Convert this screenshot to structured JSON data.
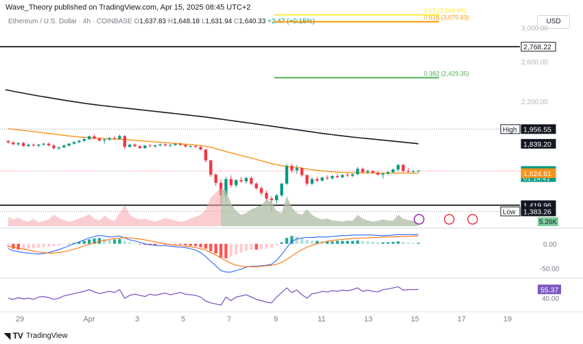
{
  "header": {
    "published": "Wave_Theory published on TradingView.com, Apr 15, 2025 08:45 UTC+2"
  },
  "legend": {
    "symbol": "Ethereum / U.S. Dollar · 4h · COINBASE",
    "o_label": "O",
    "o": "1,637.83",
    "h_label": "H",
    "h": "1,648.18",
    "l_label": "L",
    "l": "1,631.94",
    "c_label": "C",
    "c": "1,640.33",
    "change": "+2.47 (+0.15%)"
  },
  "currency_button": "USD",
  "footer": {
    "brand": "TradingView"
  },
  "colors": {
    "up": "#089981",
    "down": "#f23645",
    "ema": "#f7931a",
    "sma": "#131722",
    "fib382": "#4caf50",
    "fib618": "#ff9800",
    "fibtop": "#ffeb3b",
    "rsi": "#7e57c2",
    "macd": "#2962ff",
    "signal": "#ff6d00"
  },
  "chart_data": {
    "type": "line",
    "title": "Ethereum / U.S. Dollar · 4h · COINBASE",
    "x_ticks": [
      "29",
      "Apr",
      "3",
      "5",
      "7",
      "9",
      "11",
      "13",
      "15",
      "17",
      "19"
    ],
    "y_ticks": [
      "3,000.00",
      "2,600.00",
      "2,200.00",
      "1,956.55",
      "1,839.20",
      "1,640.33",
      "1,624.61",
      "1,419.96",
      "1,383.26"
    ],
    "price_scale": "log",
    "y_range": [
      1300,
      3200
    ],
    "price_axis_labels": [
      {
        "text": "2,768.22",
        "kind": "line"
      },
      {
        "text": "1,956.55",
        "prefix": "High",
        "kind": "dark"
      },
      {
        "text": "1,839.20",
        "kind": "dark"
      },
      {
        "text": "1,640.33",
        "sub": "01:14:41",
        "kind": "last"
      },
      {
        "text": "1,624.61",
        "kind": "ema"
      },
      {
        "text": "1,419.96",
        "kind": "dark"
      },
      {
        "text": "1,383.26",
        "prefix": "Low",
        "kind": "dark"
      }
    ],
    "horizontal_levels": [
      {
        "value": 2768.22,
        "style": "solid"
      },
      {
        "value": 1419.96,
        "style": "solid"
      },
      {
        "value": 1383.26,
        "style": "dotted"
      },
      {
        "value": 1956.55,
        "style": "dotted"
      }
    ],
    "fib_levels": [
      {
        "label": "0.382 (2,429.35)",
        "value": 2429.35
      },
      {
        "label": "0.618 (3,075.63)",
        "value": 3075.63
      },
      {
        "label": "0.65 (3,166.99)",
        "value": 3166.99
      }
    ],
    "candles": [
      [
        1860,
        1870,
        1840,
        1850
      ],
      [
        1850,
        1858,
        1828,
        1835
      ],
      [
        1835,
        1848,
        1825,
        1845
      ],
      [
        1845,
        1855,
        1815,
        1822
      ],
      [
        1822,
        1840,
        1812,
        1832
      ],
      [
        1832,
        1842,
        1818,
        1825
      ],
      [
        1825,
        1838,
        1812,
        1833
      ],
      [
        1833,
        1845,
        1826,
        1840
      ],
      [
        1840,
        1848,
        1820,
        1826
      ],
      [
        1826,
        1835,
        1795,
        1805
      ],
      [
        1805,
        1818,
        1790,
        1812
      ],
      [
        1812,
        1832,
        1805,
        1826
      ],
      [
        1826,
        1845,
        1818,
        1840
      ],
      [
        1840,
        1860,
        1832,
        1852
      ],
      [
        1852,
        1870,
        1845,
        1862
      ],
      [
        1862,
        1885,
        1855,
        1876
      ],
      [
        1876,
        1905,
        1870,
        1898
      ],
      [
        1898,
        1912,
        1872,
        1880
      ],
      [
        1880,
        1890,
        1855,
        1865
      ],
      [
        1865,
        1878,
        1840,
        1872
      ],
      [
        1872,
        1890,
        1862,
        1884
      ],
      [
        1884,
        1900,
        1870,
        1878
      ],
      [
        1878,
        1912,
        1870,
        1900
      ],
      [
        1900,
        1908,
        1800,
        1815
      ],
      [
        1815,
        1840,
        1810,
        1832
      ],
      [
        1832,
        1842,
        1815,
        1820
      ],
      [
        1820,
        1830,
        1800,
        1806
      ],
      [
        1806,
        1830,
        1800,
        1825
      ],
      [
        1825,
        1838,
        1815,
        1820
      ],
      [
        1820,
        1832,
        1806,
        1828
      ],
      [
        1828,
        1840,
        1818,
        1835
      ],
      [
        1835,
        1842,
        1820,
        1826
      ],
      [
        1826,
        1838,
        1815,
        1830
      ],
      [
        1830,
        1845,
        1822,
        1838
      ],
      [
        1838,
        1848,
        1825,
        1830
      ],
      [
        1830,
        1836,
        1812,
        1818
      ],
      [
        1818,
        1826,
        1808,
        1822
      ],
      [
        1822,
        1828,
        1810,
        1815
      ],
      [
        1815,
        1820,
        1790,
        1795
      ],
      [
        1795,
        1800,
        1700,
        1715
      ],
      [
        1715,
        1720,
        1600,
        1615
      ],
      [
        1615,
        1625,
        1540,
        1560
      ],
      [
        1560,
        1585,
        1420,
        1480
      ],
      [
        1480,
        1600,
        1440,
        1585
      ],
      [
        1585,
        1610,
        1530,
        1545
      ],
      [
        1545,
        1585,
        1530,
        1578
      ],
      [
        1578,
        1600,
        1560,
        1570
      ],
      [
        1570,
        1600,
        1555,
        1592
      ],
      [
        1592,
        1605,
        1545,
        1555
      ],
      [
        1555,
        1565,
        1515,
        1525
      ],
      [
        1525,
        1540,
        1480,
        1495
      ],
      [
        1495,
        1510,
        1440,
        1460
      ],
      [
        1460,
        1475,
        1383,
        1450
      ],
      [
        1450,
        1490,
        1430,
        1480
      ],
      [
        1480,
        1560,
        1470,
        1555
      ],
      [
        1555,
        1690,
        1545,
        1675
      ],
      [
        1675,
        1690,
        1630,
        1645
      ],
      [
        1645,
        1680,
        1620,
        1660
      ],
      [
        1660,
        1665,
        1600,
        1612
      ],
      [
        1612,
        1618,
        1540,
        1555
      ],
      [
        1555,
        1595,
        1545,
        1585
      ],
      [
        1585,
        1600,
        1565,
        1575
      ],
      [
        1575,
        1600,
        1568,
        1595
      ],
      [
        1595,
        1610,
        1580,
        1590
      ],
      [
        1590,
        1612,
        1582,
        1605
      ],
      [
        1605,
        1620,
        1592,
        1598
      ],
      [
        1598,
        1618,
        1590,
        1612
      ],
      [
        1612,
        1625,
        1600,
        1608
      ],
      [
        1608,
        1622,
        1598,
        1618
      ],
      [
        1618,
        1668,
        1612,
        1655
      ],
      [
        1655,
        1665,
        1625,
        1632
      ],
      [
        1632,
        1650,
        1620,
        1640
      ],
      [
        1640,
        1648,
        1622,
        1628
      ],
      [
        1628,
        1640,
        1610,
        1615
      ],
      [
        1615,
        1628,
        1590,
        1622
      ],
      [
        1622,
        1640,
        1612,
        1632
      ],
      [
        1632,
        1658,
        1625,
        1650
      ],
      [
        1650,
        1690,
        1640,
        1682
      ],
      [
        1682,
        1692,
        1630,
        1640
      ],
      [
        1640,
        1660,
        1625,
        1635
      ],
      [
        1635,
        1648,
        1630,
        1637
      ],
      [
        1637,
        1648,
        1631,
        1640
      ]
    ],
    "ema": [
      1960,
      1955,
      1950,
      1946,
      1941,
      1936,
      1931,
      1926,
      1921,
      1916,
      1911,
      1906,
      1901,
      1897,
      1893,
      1890,
      1887,
      1885,
      1883,
      1880,
      1878,
      1876,
      1874,
      1872,
      1869,
      1866,
      1863,
      1860,
      1857,
      1854,
      1851,
      1848,
      1845,
      1842,
      1839,
      1836,
      1833,
      1830,
      1826,
      1820,
      1812,
      1802,
      1790,
      1780,
      1770,
      1760,
      1750,
      1741,
      1732,
      1722,
      1712,
      1702,
      1692,
      1684,
      1677,
      1673,
      1669,
      1665,
      1660,
      1654,
      1649,
      1645,
      1641,
      1637,
      1634,
      1632,
      1630,
      1629,
      1628,
      1628,
      1627,
      1627,
      1626,
      1626,
      1625,
      1625,
      1625,
      1626,
      1626,
      1625,
      1625,
      1624.61
    ],
    "sma200": [
      2310,
      2300,
      2290,
      2281,
      2272,
      2263,
      2254,
      2246,
      2238,
      2230,
      2222,
      2214,
      2206,
      2199,
      2192,
      2185,
      2178,
      2172,
      2166,
      2160,
      2155,
      2150,
      2145,
      2140,
      2135,
      2130,
      2125,
      2120,
      2115,
      2110,
      2105,
      2100,
      2095,
      2090,
      2085,
      2080,
      2075,
      2070,
      2065,
      2060,
      2054,
      2048,
      2042,
      2036,
      2030,
      2024,
      2018,
      2012,
      2006,
      2000,
      1994,
      1988,
      1982,
      1976,
      1970,
      1964,
      1958,
      1952,
      1946,
      1940,
      1934,
      1928,
      1922,
      1917,
      1912,
      1907,
      1902,
      1897,
      1892,
      1888,
      1884,
      1880,
      1876,
      1872,
      1868,
      1864,
      1860,
      1856,
      1852,
      1848,
      1844,
      1839.2
    ],
    "volume": {
      "last_label": "5.26K",
      "values": [
        0.25,
        0.18,
        0.22,
        0.15,
        0.12,
        0.2,
        0.1,
        0.14,
        0.18,
        0.3,
        0.22,
        0.16,
        0.12,
        0.15,
        0.2,
        0.25,
        0.32,
        0.2,
        0.15,
        0.28,
        0.18,
        0.14,
        0.35,
        0.55,
        0.3,
        0.22,
        0.18,
        0.2,
        0.15,
        0.12,
        0.16,
        0.22,
        0.18,
        0.15,
        0.12,
        0.14,
        0.2,
        0.25,
        0.3,
        0.45,
        0.75,
        0.9,
        1.0,
        0.95,
        0.6,
        0.4,
        0.3,
        0.35,
        0.45,
        0.5,
        0.55,
        0.7,
        0.65,
        0.4,
        0.35,
        0.8,
        0.5,
        0.35,
        0.3,
        0.45,
        0.3,
        0.22,
        0.18,
        0.2,
        0.15,
        0.14,
        0.12,
        0.15,
        0.14,
        0.3,
        0.2,
        0.15,
        0.12,
        0.14,
        0.18,
        0.15,
        0.14,
        0.3,
        0.2,
        0.16,
        0.14,
        0.15
      ]
    },
    "macd": {
      "y_ticks": [
        "0.00",
        "-50.00"
      ],
      "hist": [
        -8,
        -10,
        -12,
        -11,
        -10,
        -9,
        -8,
        -7,
        -6,
        -5,
        -4,
        -2,
        0,
        2,
        4,
        6,
        9,
        11,
        12,
        10,
        8,
        9,
        10,
        6,
        3,
        1,
        -1,
        -2,
        -3,
        -3,
        -2,
        -2,
        -1,
        -1,
        -2,
        -3,
        -4,
        -5,
        -7,
        -10,
        -15,
        -20,
        -28,
        -30,
        -26,
        -22,
        -18,
        -14,
        -12,
        -12,
        -11,
        -10,
        -8,
        -3,
        3,
        12,
        16,
        15,
        12,
        8,
        6,
        6,
        5,
        5,
        5,
        6,
        6,
        6,
        6,
        7,
        6,
        5,
        4,
        3,
        3,
        3,
        4,
        5,
        4,
        3,
        2,
        2
      ],
      "macd": [
        -10,
        -14,
        -16,
        -18,
        -19,
        -20,
        -21,
        -20,
        -18,
        -15,
        -12,
        -8,
        -4,
        0,
        4,
        8,
        12,
        15,
        17,
        16,
        14,
        15,
        16,
        12,
        8,
        6,
        3,
        0,
        -2,
        -3,
        -4,
        -4,
        -5,
        -6,
        -7,
        -8,
        -10,
        -13,
        -18,
        -26,
        -36,
        -45,
        -55,
        -58,
        -58,
        -55,
        -52,
        -48,
        -46,
        -46,
        -45,
        -44,
        -42,
        -34,
        -22,
        -8,
        5,
        10,
        12,
        13,
        13,
        14,
        14,
        14,
        15,
        16,
        17,
        17,
        18,
        18,
        18,
        18,
        18,
        17,
        17,
        17,
        18,
        19,
        19,
        19,
        19,
        19
      ],
      "signal": [
        -5,
        -7,
        -9,
        -11,
        -13,
        -15,
        -17,
        -18,
        -19,
        -19,
        -18,
        -16,
        -14,
        -11,
        -8,
        -4,
        -1,
        2,
        5,
        7,
        9,
        11,
        12,
        13,
        12,
        11,
        10,
        8,
        6,
        4,
        2,
        0,
        -2,
        -3,
        -4,
        -5,
        -6,
        -8,
        -10,
        -13,
        -18,
        -23,
        -29,
        -35,
        -40,
        -44,
        -46,
        -47,
        -47,
        -47,
        -46,
        -45,
        -44,
        -42,
        -38,
        -32,
        -25,
        -18,
        -12,
        -7,
        -3,
        0,
        3,
        5,
        7,
        8,
        9,
        10,
        11,
        11,
        12,
        12,
        13,
        13,
        14,
        14,
        14,
        15,
        15,
        15,
        16,
        16
      ],
      "range": [
        -65,
        25
      ]
    },
    "rsi": {
      "last_label": "55.37",
      "y_ticks": [
        "40.00"
      ],
      "values": [
        40,
        38,
        41,
        39,
        40,
        38,
        42,
        43,
        41,
        38,
        40,
        44,
        46,
        48,
        50,
        52,
        55,
        51,
        48,
        50,
        52,
        50,
        55,
        40,
        45,
        47,
        45,
        43,
        47,
        45,
        47,
        49,
        46,
        48,
        50,
        47,
        46,
        45,
        42,
        35,
        32,
        30,
        28,
        42,
        36,
        42,
        44,
        46,
        42,
        38,
        36,
        33,
        32,
        42,
        50,
        58,
        50,
        54,
        46,
        40,
        48,
        49,
        52,
        51,
        53,
        52,
        54,
        53,
        55,
        58,
        52,
        54,
        52,
        51,
        55,
        56,
        58,
        60,
        54,
        55,
        55,
        55.37
      ],
      "range": [
        20,
        70
      ]
    }
  }
}
